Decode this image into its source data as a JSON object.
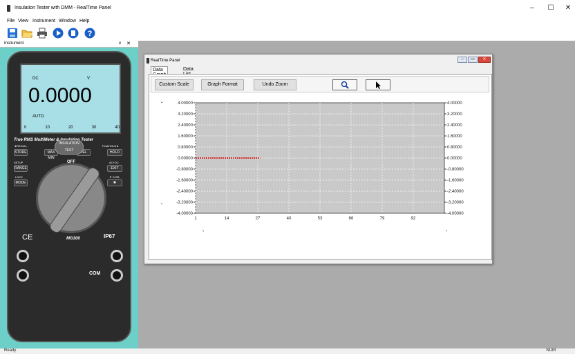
{
  "app": {
    "title": "Insulation Tester with DMM - RealTime Panel",
    "window_controls": {
      "minimize": "–",
      "maximize": "☐",
      "close": "✕"
    }
  },
  "menu": [
    "File",
    "View",
    "Instrument",
    "Window",
    "Help"
  ],
  "toolbar": {
    "buttons": [
      "save-icon",
      "open-folder-icon",
      "print-icon",
      "play-icon",
      "stop-icon",
      "help-icon"
    ]
  },
  "instrument_panel": {
    "title": "Instrument",
    "controls": "ᵠ ✕"
  },
  "meter": {
    "lcd_mode": "DC",
    "lcd_unit": "V",
    "reading": "0.0000",
    "range_mode": "AUTO",
    "bargraph_scale": [
      "0",
      "10",
      "20",
      "30",
      "40"
    ],
    "brand_text": "True RMS MultiMeter & Insulation Tester",
    "buttons": {
      "store": "STORE",
      "maxmin": "MAX MIN",
      "rel": "REL",
      "hold": "HOLD",
      "range": "RANGE",
      "exit": "EXIT",
      "mode": "MODE",
      "insulation": "INSULATION TEST"
    },
    "labels": {
      "recall": "◄RECALL",
      "peakhold": "PeakHOLD►",
      "setup": "SETUP",
      "acdc": "AC+DC",
      "lock": "LOCK",
      "usb": "▼+USB"
    },
    "dial_off": "OFF",
    "model": "MG300",
    "ip_rating": "IP67",
    "jack_label_com": "COM"
  },
  "realtime_panel": {
    "title": "RealTime Panel",
    "tabs": [
      "Data Graph",
      "Data List"
    ],
    "buttons": {
      "custom_scale": "Custom Scale",
      "graph_format": "Graph Format",
      "undo_zoom": "Undo Zoom"
    }
  },
  "chart_data": {
    "type": "line",
    "x_ticks": [
      "1",
      "14",
      "27",
      "40",
      "53",
      "66",
      "79",
      "92"
    ],
    "y_ticks_left": [
      "4.00000",
      "3.20000",
      "2.40000",
      "1.60000",
      "0.80000",
      "0.00000",
      "-0.80000",
      "-1.60000",
      "-2.40000",
      "-3.20000",
      "-4.00000"
    ],
    "y_ticks_right": [
      "4.00000",
      "3.20000",
      "2.40000",
      "1.60000",
      "0.80000",
      "0.00000",
      "-0.80000",
      "-1.60000",
      "-2.40000",
      "-3.20000",
      "-4.00000"
    ],
    "ylim": [
      -4,
      4
    ],
    "xlim": [
      1,
      105
    ],
    "grid": true,
    "series": [
      {
        "color": "#d40000",
        "x": [
          1,
          28
        ],
        "y": [
          0,
          0
        ]
      }
    ]
  },
  "status": {
    "left": "Ready",
    "right": "NUM"
  }
}
